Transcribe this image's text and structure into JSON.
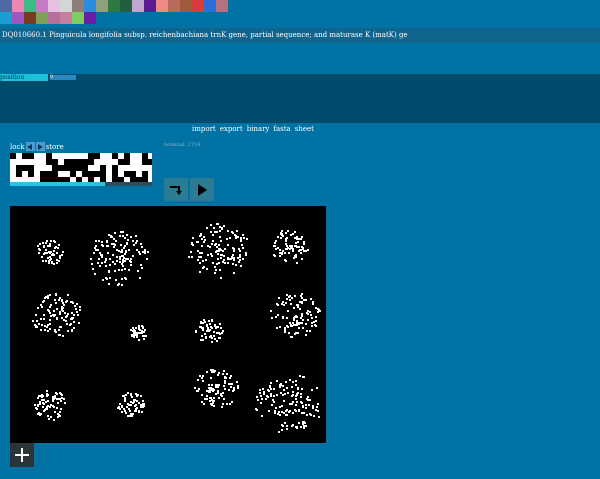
{
  "palette": {
    "row1": [
      "#4f69a6",
      "#ee86b5",
      "#3bbe85",
      "#c779c7",
      "#e7c1e0",
      "#d1d6d7",
      "#8d7f78",
      "#2a8de0",
      "#8fa07e",
      "#2e7a3e",
      "#215f3e",
      "#c1a7cd",
      "#5b1c92",
      "#ee8b87",
      "#b96a5a",
      "#9f5b3c",
      "#d83c3c",
      "#2c6ed8",
      "#b5727e"
    ],
    "row2": [
      "#1d9ed3",
      "#9e56c0",
      "#7a3a22",
      "#7ea058",
      "#b86e9a",
      "#c6809f",
      "#7dcd60",
      "#6a1fa8"
    ]
  },
  "document": {
    "title": "DQ010660.1 Pinguicula longifolia subsp. reichenbachiana trnK gene, partial sequence; and maturase K (matK) ge"
  },
  "position": {
    "label": "position",
    "value": "0"
  },
  "menu": {
    "import": "import",
    "export": "export",
    "binary": "binary",
    "fasta": "fasta",
    "sheet": "sheet"
  },
  "lock_row": {
    "lock": "lock",
    "store": "store",
    "prev_icon": "triangle-left",
    "next_icon": "triangle-right"
  },
  "nominal": {
    "text": "nominal: 2719"
  },
  "progress": {
    "fraction": 0.67
  },
  "controls": {
    "step_icon": "step-return-arrow",
    "play_icon": "play-triangle"
  },
  "add": {
    "icon": "plus"
  },
  "colors": {
    "background": "#0072a3",
    "panel": "#004b6b",
    "accent": "#29c3e5",
    "canvas": "#000000"
  }
}
